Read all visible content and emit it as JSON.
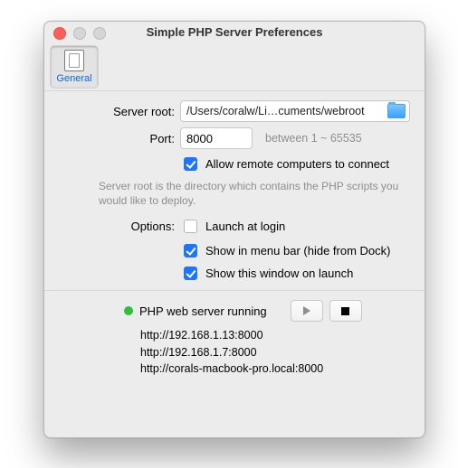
{
  "window": {
    "title": "Simple PHP Server Preferences"
  },
  "toolbar": {
    "general": "General"
  },
  "labels": {
    "server_root": "Server root:",
    "port": "Port:",
    "options": "Options:"
  },
  "fields": {
    "server_root_path": "/Users/coralw/Li…cuments/webroot",
    "port_value": "8000",
    "port_hint": "between 1 ~ 65535"
  },
  "checks": {
    "allow_remote": "Allow remote computers to connect",
    "launch_login": "Launch at login",
    "show_menubar": "Show in menu bar (hide from Dock)",
    "show_window": "Show this window on launch"
  },
  "helptext": "Server root is the directory which contains the PHP scripts you would like to deploy.",
  "status": {
    "text": "PHP web server running",
    "urls": {
      "u1": "http://192.168.1.13:8000",
      "u2": "http://192.168.1.7:8000",
      "u3": "http://corals-macbook-pro.local:8000"
    }
  }
}
